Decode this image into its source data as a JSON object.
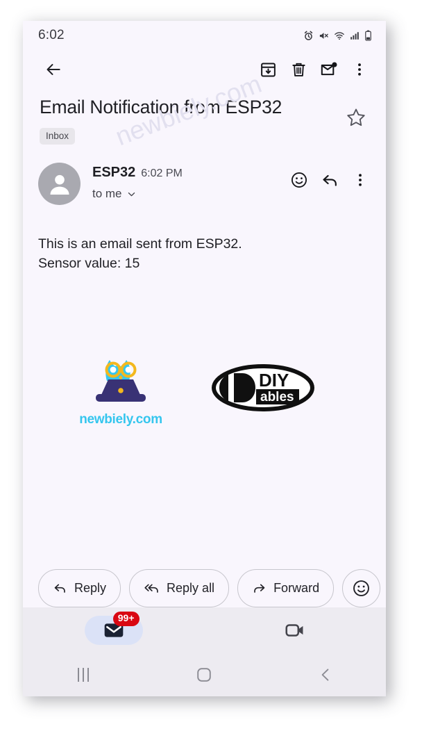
{
  "status_bar": {
    "time": "6:02",
    "icons": [
      "alarm-icon",
      "mute-icon",
      "wifi-icon",
      "signal-icon",
      "battery-icon"
    ]
  },
  "toolbar": {
    "back_icon": "back-arrow-icon",
    "archive_icon": "archive-icon",
    "delete_icon": "trash-icon",
    "mark_unread_icon": "mark-unread-icon",
    "more_icon": "more-vertical-icon"
  },
  "email": {
    "subject": "Email Notification from ESP32",
    "label": "Inbox",
    "starred": false,
    "sender_name": "ESP32",
    "time": "6:02 PM",
    "recipient": "to me",
    "body_line1": "This is an email sent from ESP32.",
    "body_line2": "Sensor value: 15"
  },
  "sender_actions": {
    "emoji_icon": "smiley-icon",
    "reply_icon": "reply-arrow-icon",
    "more_icon": "more-vertical-icon"
  },
  "logos": {
    "owl_caption": "newbiely.com",
    "owl_body_color": "#35c6ee",
    "owl_glasses_color": "#f3b81e",
    "owl_laptop_color": "#393275",
    "diy_text": "DIY",
    "diy_sub_text": "ables"
  },
  "reply_bar": {
    "reply_label": "Reply",
    "reply_all_label": "Reply all",
    "forward_label": "Forward",
    "emoji_icon": "smiley-icon"
  },
  "bottom_nav": {
    "mail_badge": "99+",
    "mail_icon": "mail-icon",
    "meet_icon": "video-camera-icon",
    "accent_pill_color": "#dbe2f7",
    "badge_color": "#d90712"
  },
  "android_nav": {
    "recents_icon": "recents-icon",
    "home_icon": "home-icon",
    "back_icon": "back-chevron-icon"
  },
  "watermark": {
    "text": "newbiely.com",
    "color": "#e2e0ef"
  }
}
